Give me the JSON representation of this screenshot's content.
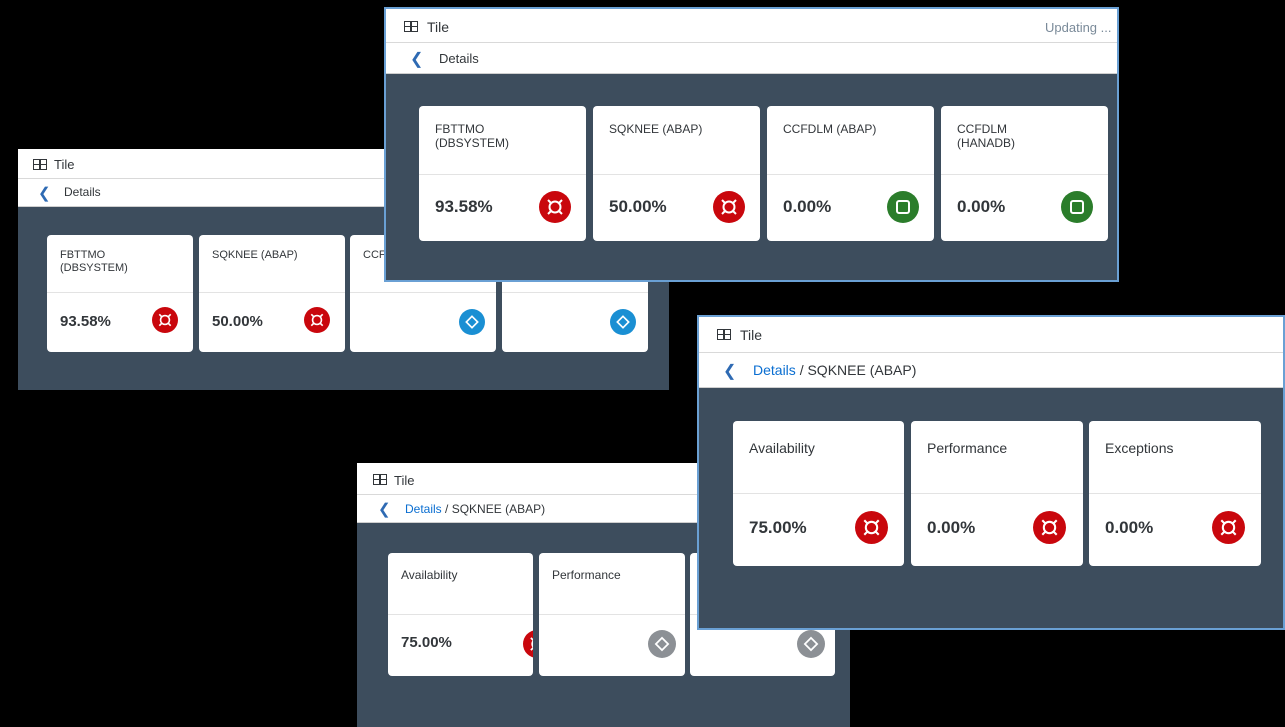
{
  "panel1": {
    "title": "Tile",
    "breadcrumb": "Details",
    "tiles": [
      {
        "name": "FBTTMO (DBSYSTEM)",
        "value": "93.58%",
        "status_icon": "alert-icon",
        "status_color": "#c9070d"
      },
      {
        "name": "SQKNEE (ABAP)",
        "value": "50.00%",
        "status_icon": "alert-icon",
        "status_color": "#c9070d"
      },
      {
        "name": "CCF",
        "value": "",
        "status_icon": "diamond-icon",
        "status_color": "#1a8fd3"
      },
      {
        "name": "",
        "value": "",
        "status_icon": "diamond-icon",
        "status_color": "#1a8fd3"
      }
    ]
  },
  "panel2": {
    "title": "Tile",
    "status": "Updating ...",
    "breadcrumb": "Details",
    "tiles": [
      {
        "name": "FBTTMO (DBSYSTEM)",
        "value": "93.58%",
        "status_icon": "alert-icon",
        "status_color": "#c9070d"
      },
      {
        "name": "SQKNEE (ABAP)",
        "value": "50.00%",
        "status_icon": "alert-icon",
        "status_color": "#c9070d"
      },
      {
        "name": "CCFDLM (ABAP)",
        "value": "0.00%",
        "status_icon": "square-icon",
        "status_color": "#2b7d2b"
      },
      {
        "name": "CCFDLM (HANADB)",
        "value": "0.00%",
        "status_icon": "square-icon",
        "status_color": "#2b7d2b"
      }
    ]
  },
  "panel3": {
    "title": "Tile",
    "breadcrumb_link": "Details",
    "breadcrumb_sep": "/",
    "breadcrumb_current": "SQKNEE (ABAP)",
    "tiles": [
      {
        "name": "Availability",
        "value": "75.00%",
        "status_icon": "alert-icon",
        "status_color": "#c9070d"
      },
      {
        "name": "Performance",
        "value": "",
        "status_icon": "diamond-icon",
        "status_color": "#8c9095"
      },
      {
        "name": "",
        "value": "",
        "status_icon": "diamond-icon",
        "status_color": "#8c9095"
      }
    ]
  },
  "panel4": {
    "title": "Tile",
    "breadcrumb_link": "Details",
    "breadcrumb_sep": "/",
    "breadcrumb_current": "SQKNEE (ABAP)",
    "tiles": [
      {
        "name": "Availability",
        "value": "75.00%",
        "status_icon": "alert-icon",
        "status_color": "#c9070d"
      },
      {
        "name": "Performance",
        "value": "0.00%",
        "status_icon": "alert-icon",
        "status_color": "#c9070d"
      },
      {
        "name": "Exceptions",
        "value": "0.00%",
        "status_icon": "alert-icon",
        "status_color": "#c9070d"
      }
    ]
  }
}
